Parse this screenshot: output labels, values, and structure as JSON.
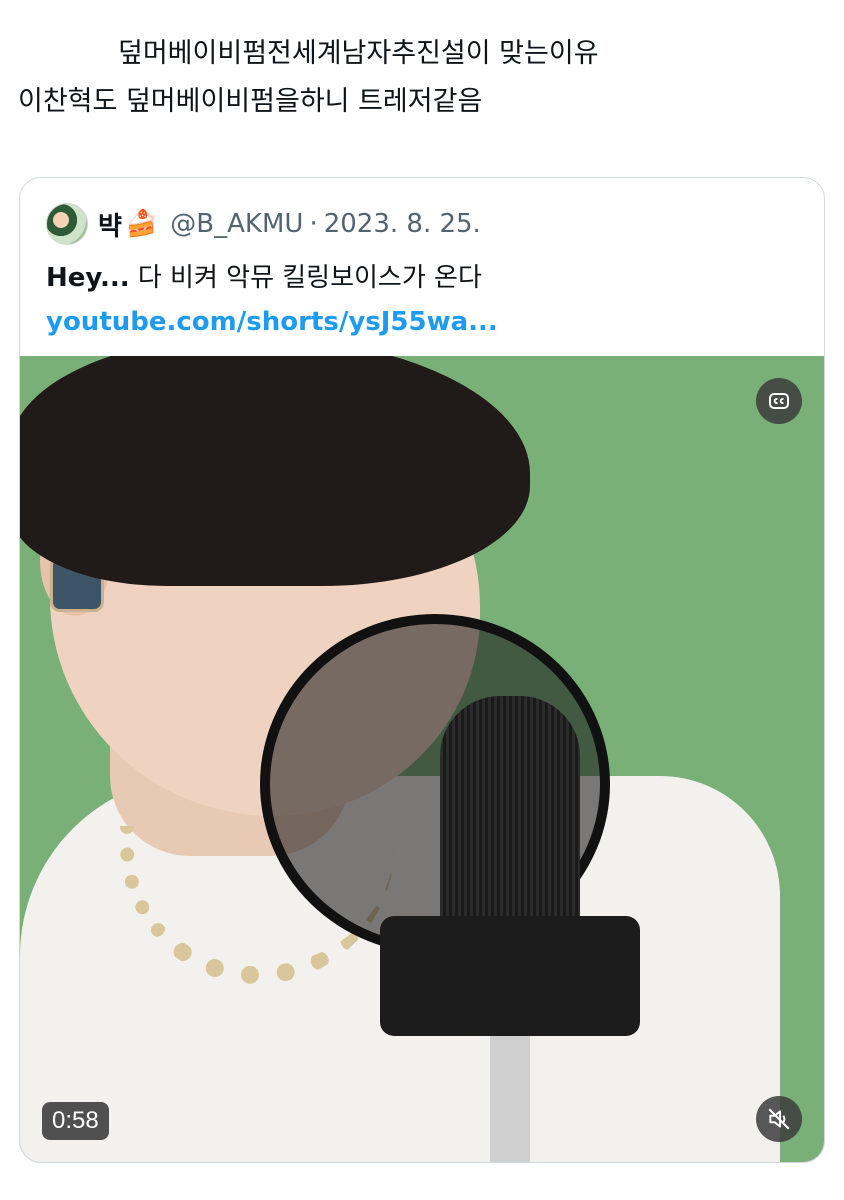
{
  "post": {
    "line1": "덮머베이비펌전세계남자추진설이 맞는이유",
    "line2": "이찬혁도 덮머베이비펌을하니 트레저같음"
  },
  "quote": {
    "display_name": "뱍",
    "cake_emoji": "🍰",
    "handle": "@B_AKMU",
    "separator": "·",
    "date": "2023. 8. 25.",
    "text_bold": "Hey...",
    "text_rest": " 다 비켜 악뮤 킬링보이스가 온다",
    "link": "youtube.com/shorts/ysJ55wa..."
  },
  "video": {
    "duration": "0:58",
    "cc_icon": "closed-captions-icon",
    "mute_icon": "muted-speaker-icon"
  },
  "colors": {
    "link": "#1d9bf0",
    "secondary_text": "#536471",
    "border": "#cfd9de",
    "video_background": "#78b078"
  }
}
